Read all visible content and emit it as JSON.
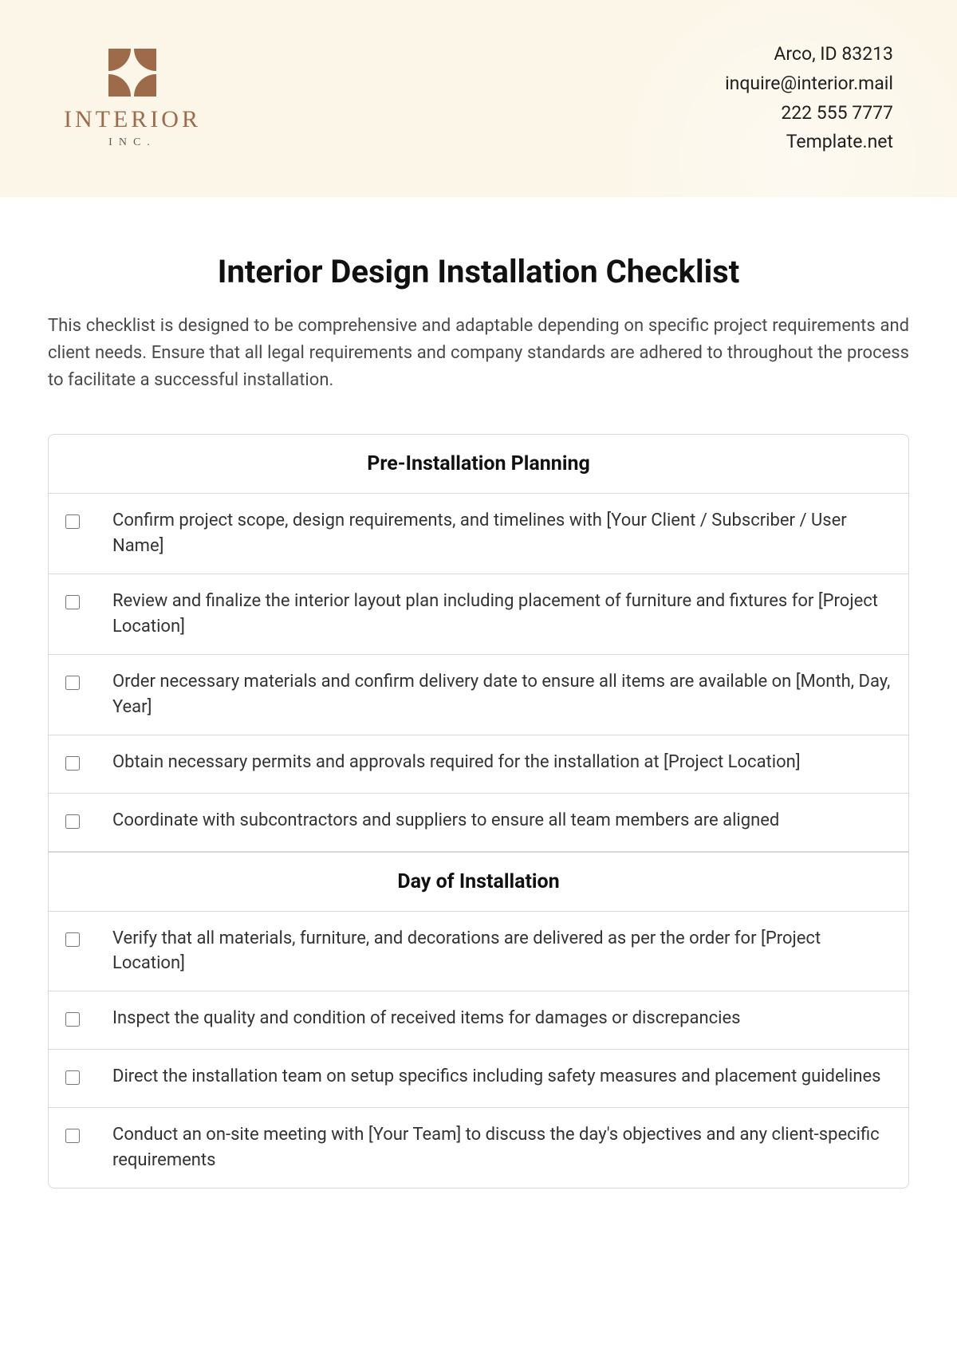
{
  "header": {
    "logo_name": "INTERIOR",
    "logo_sub": "INC.",
    "contact": {
      "address": "Arco, ID 83213",
      "email": "inquire@interior.mail",
      "phone": "222 555 7777",
      "site": "Template.net"
    }
  },
  "document": {
    "title": "Interior Design Installation Checklist",
    "intro": "This checklist is designed to be comprehensive and adaptable depending on specific project requirements and client needs. Ensure that all legal requirements and company standards are adhered to throughout the process to facilitate a successful installation."
  },
  "sections": [
    {
      "heading": "Pre-Installation Planning",
      "items": [
        "Confirm project scope, design requirements, and timelines with [Your Client / Subscriber / User Name]",
        "Review and finalize the interior layout plan including placement of furniture and fixtures for [Project Location]",
        "Order necessary materials and confirm delivery date to ensure all items are available on [Month, Day, Year]",
        "Obtain necessary permits and approvals required for the installation at [Project Location]",
        "Coordinate with subcontractors and suppliers to ensure all team members are aligned"
      ]
    },
    {
      "heading": "Day of Installation",
      "items": [
        "Verify that all materials, furniture, and decorations are delivered as per the order for [Project Location]",
        "Inspect the quality and condition of received items for damages or discrepancies",
        "Direct the installation team on setup specifics including safety measures and placement guidelines",
        "Conduct an on-site meeting with [Your Team] to discuss the day's objectives and any client-specific requirements"
      ]
    }
  ]
}
